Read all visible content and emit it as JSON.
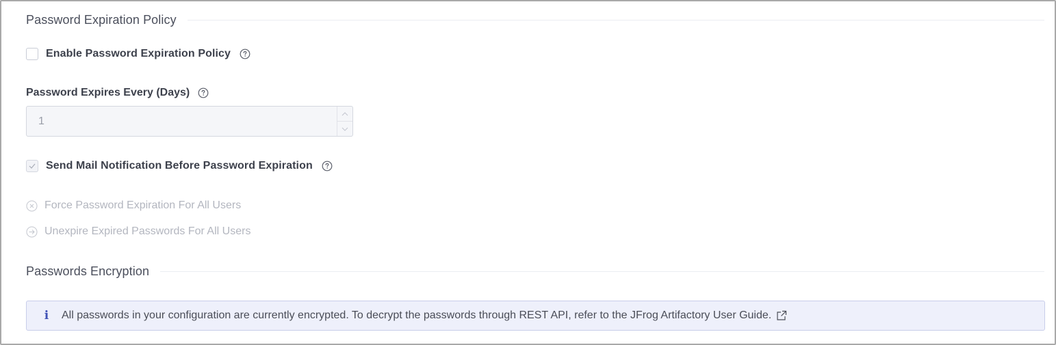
{
  "password_expiration": {
    "section_title": "Password Expiration Policy",
    "enable_label": "Enable Password Expiration Policy",
    "enable_checked": false,
    "days_label": "Password Expires Every (Days)",
    "days_value": "1",
    "mail_label": "Send Mail Notification Before Password Expiration",
    "mail_checked": true,
    "force_action": "Force Password Expiration For All Users",
    "unexpire_action": "Unexpire Expired Passwords For All Users"
  },
  "passwords_encryption": {
    "section_title": "Passwords Encryption",
    "info_icon": "i",
    "info_text": "All passwords in your configuration are currently encrypted. To decrypt the passwords through REST API, refer to the JFrog Artifactory User Guide."
  },
  "icons": {
    "help": "question-circle-icon",
    "force": "x-circle-icon",
    "unexpire": "arrow-right-circle-icon",
    "external": "external-link-icon"
  },
  "colors": {
    "accent": "#3f51b5",
    "banner_bg": "#eef0fb",
    "banner_border": "#c8cdea",
    "disabled_text": "#b3b6bf"
  }
}
